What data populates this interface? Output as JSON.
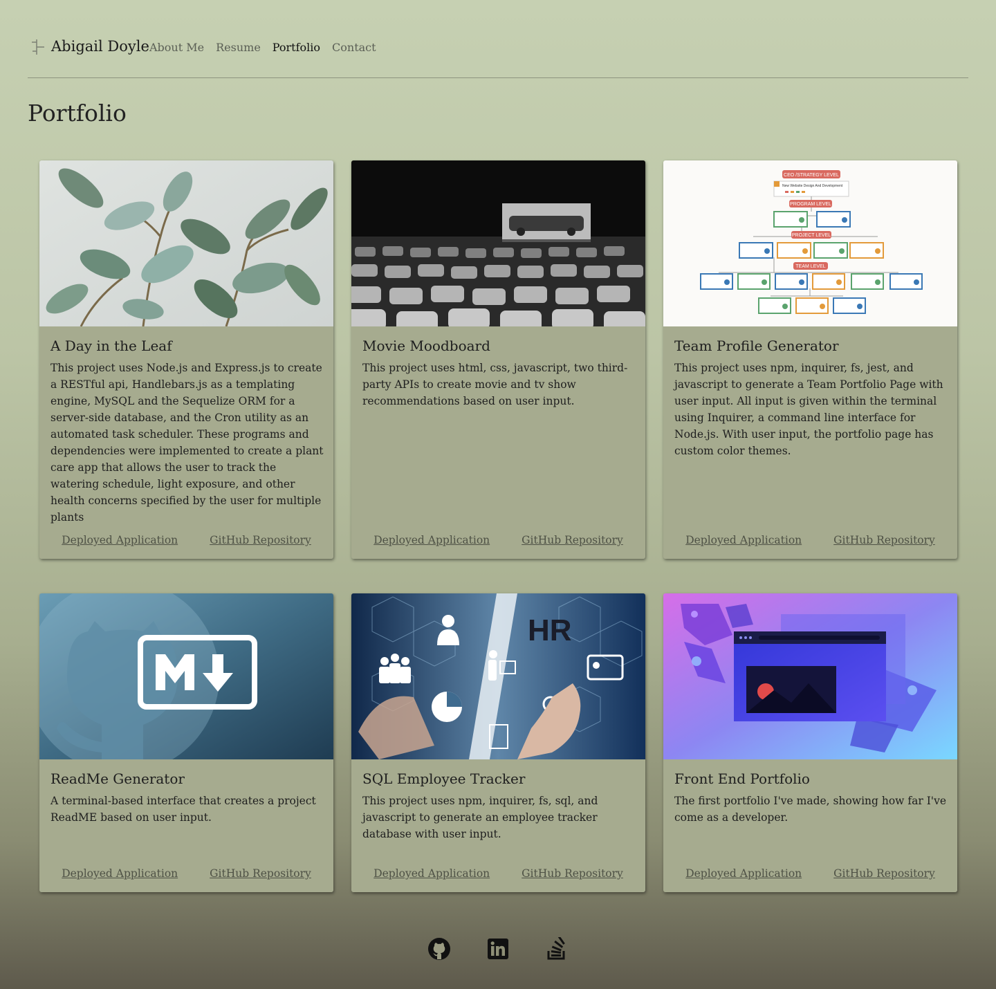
{
  "header": {
    "brand": "Abigail Doyle",
    "nav": [
      "About Me",
      "Resume",
      "Portfolio",
      "Contact"
    ],
    "active": "Portfolio"
  },
  "page_title": "Portfolio",
  "cards": [
    {
      "title": "A Day in the Leaf",
      "description": "This project uses Node.js and Express.js to create a RESTful api, Handlebars.js as a templating engine, MySQL and the Sequelize ORM for a server-side database, and the Cron utility as an automated task scheduler. These programs and dependencies were implemented to create a plant care app that allows the user to track the watering schedule, light exposure, and other health concerns specified by the user for multiple plants",
      "deployed": "Deployed Application",
      "github": "GitHub Repository",
      "image": "plant-leaves-photo"
    },
    {
      "title": "Movie Moodboard",
      "description": "This project uses html, css, javascript, two third-party APIs to create movie and tv show recommendations based on user input.",
      "deployed": "Deployed Application",
      "github": "GitHub Repository",
      "image": "drive-in-theater-photo"
    },
    {
      "title": "Team Profile Generator",
      "description": "This project uses npm, inquirer, fs, jest, and javascript to generate a Team Portfolio Page with user input. All input is given within the terminal using Inquirer, a command line interface for Node.js. With user input, the portfolio page has custom color themes.",
      "deployed": "Deployed Application",
      "github": "GitHub Repository",
      "image": "org-chart-diagram",
      "org_labels": [
        "CEO /STRATEGY LEVEL",
        "New Website Design And Development",
        "PROGRAM LEVEL",
        "PROJECT LEVEL",
        "TEAM LEVEL"
      ]
    },
    {
      "title": "ReadMe Generator",
      "description": "A terminal-based interface that creates a project ReadME based on user input.",
      "deployed": "Deployed Application",
      "github": "GitHub Repository",
      "image": "markdown-logo-graphic"
    },
    {
      "title": "SQL Employee Tracker",
      "description": "This project uses npm, inquirer, fs, sql, and javascript to generate an employee tracker database with user input.",
      "deployed": "Deployed Application",
      "github": "GitHub Repository",
      "image": "hr-technology-graphic",
      "hr_text": "HR"
    },
    {
      "title": "Front End Portfolio",
      "description": "The first portfolio I've made, showing how far I've come as a developer.",
      "deployed": "Deployed Application",
      "github": "GitHub Repository",
      "image": "browser-window-illustration"
    }
  ],
  "footer": {
    "icons": [
      "github-icon",
      "linkedin-icon",
      "stackoverflow-icon"
    ]
  },
  "colors": {
    "card_bg": "#a6ab8f",
    "link": "#4e5145",
    "bg_top": "#c6d0b2",
    "bg_bottom": "#5e5a4c"
  }
}
